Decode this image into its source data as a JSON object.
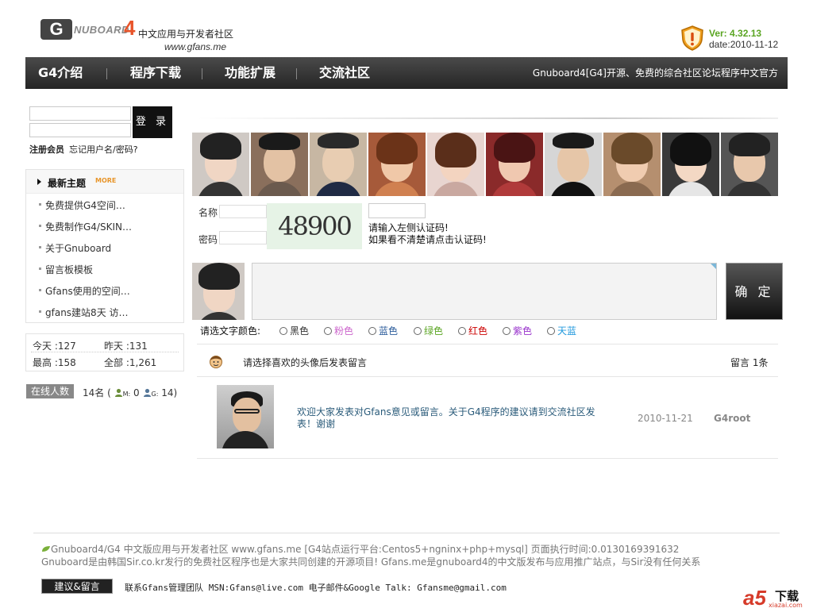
{
  "header": {
    "logo_letter": "G",
    "logo_board": "NUBOARD",
    "logo_num": "4",
    "logo_cn": "中文应用与开发者社区",
    "logo_url": "www.gfans.me",
    "version": "Ver: 4.32.13",
    "date": "date:2010-11-12"
  },
  "nav": {
    "items": [
      "G4介绍",
      "程序下载",
      "功能扩展",
      "交流社区"
    ],
    "slogan": "Gnuboard4[G4]开源、免费的综合社区论坛程序中文官方"
  },
  "login": {
    "button": "登 录",
    "register": "注册会员",
    "forgot": "忘记用户名/密码?"
  },
  "latest": {
    "title": "最新主题",
    "more": "MORE",
    "items": [
      "免费提供G4空间…",
      "免费制作G4/SKIN…",
      "关于Gnuboard",
      "留言板模板",
      "Gfans使用的空间…",
      "gfans建站8天 访…"
    ]
  },
  "stats": {
    "today_label": "今天",
    "today": ":127",
    "yesterday_label": "昨天",
    "yesterday": ":131",
    "max_label": "最高",
    "max": ":158",
    "total_label": "全部",
    "total": ":1,261"
  },
  "online": {
    "badge": "在线人数",
    "text": "14名 (",
    "m_label": "M:",
    "m_val": "0",
    "g_label": "G:",
    "g_val": "14)"
  },
  "form": {
    "name_label": "名称",
    "pass_label": "密码",
    "captcha": "48900",
    "note1": "请输入左侧认证码!",
    "note2": "如果看不清楚请点击认证码!",
    "submit": "确 定",
    "color_label": "请选文字颜色:",
    "colors": [
      {
        "label": "黑色",
        "color": "#333333"
      },
      {
        "label": "粉色",
        "color": "#cc66cc"
      },
      {
        "label": "蓝色",
        "color": "#2a5b9a"
      },
      {
        "label": "绿色",
        "color": "#5aa522"
      },
      {
        "label": "红色",
        "color": "#cc0000"
      },
      {
        "label": "紫色",
        "color": "#9933cc"
      },
      {
        "label": "天蓝",
        "color": "#2299dd"
      }
    ]
  },
  "list": {
    "title": "请选择喜欢的头像后发表留言",
    "count": "留言 1条",
    "post": {
      "text": "欢迎大家发表对Gfans意见或留言。关于G4程序的建议请到交流社区发表！谢谢",
      "date": "2010-11-21",
      "user": "G4root"
    }
  },
  "footer": {
    "line1": "Gnuboard4/G4 中文版应用与开发者社区  www.gfans.me [G4站点运行平台:Centos5+ngninx+php+mysql] 页面执行时间:0.0130169391632",
    "line2": "Gnuboard是由韩国Sir.co.kr发行的免费社区程序也是大家共同创建的开源项目!   Gfans.me是gnuboard4的中文版发布与应用推广站点，与Sir没有任何关系",
    "suggest": "建议&留言",
    "contact": "联系Gfans管理团队 MSN:Gfans@live.com 电子邮件&Google Talk: Gfansme@gmail.com",
    "a5_logo": "a5",
    "a5_text": "下载",
    "a5_url": "xiazai.com"
  }
}
